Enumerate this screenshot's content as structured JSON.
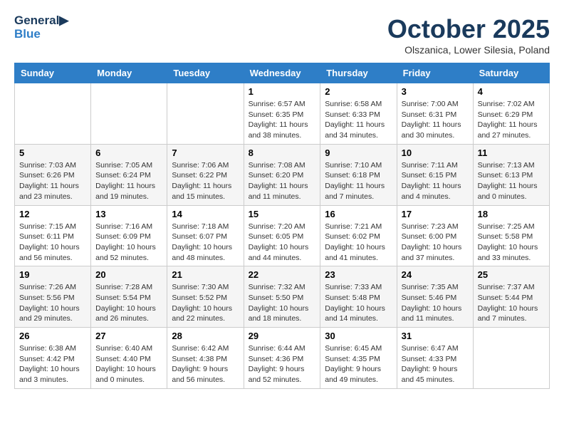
{
  "header": {
    "logo_line1": "General",
    "logo_line2": "Blue",
    "month_title": "October 2025",
    "subtitle": "Olszanica, Lower Silesia, Poland"
  },
  "weekdays": [
    "Sunday",
    "Monday",
    "Tuesday",
    "Wednesday",
    "Thursday",
    "Friday",
    "Saturday"
  ],
  "weeks": [
    [
      {
        "day": "",
        "info": ""
      },
      {
        "day": "",
        "info": ""
      },
      {
        "day": "",
        "info": ""
      },
      {
        "day": "1",
        "info": "Sunrise: 6:57 AM\nSunset: 6:35 PM\nDaylight: 11 hours\nand 38 minutes."
      },
      {
        "day": "2",
        "info": "Sunrise: 6:58 AM\nSunset: 6:33 PM\nDaylight: 11 hours\nand 34 minutes."
      },
      {
        "day": "3",
        "info": "Sunrise: 7:00 AM\nSunset: 6:31 PM\nDaylight: 11 hours\nand 30 minutes."
      },
      {
        "day": "4",
        "info": "Sunrise: 7:02 AM\nSunset: 6:29 PM\nDaylight: 11 hours\nand 27 minutes."
      }
    ],
    [
      {
        "day": "5",
        "info": "Sunrise: 7:03 AM\nSunset: 6:26 PM\nDaylight: 11 hours\nand 23 minutes."
      },
      {
        "day": "6",
        "info": "Sunrise: 7:05 AM\nSunset: 6:24 PM\nDaylight: 11 hours\nand 19 minutes."
      },
      {
        "day": "7",
        "info": "Sunrise: 7:06 AM\nSunset: 6:22 PM\nDaylight: 11 hours\nand 15 minutes."
      },
      {
        "day": "8",
        "info": "Sunrise: 7:08 AM\nSunset: 6:20 PM\nDaylight: 11 hours\nand 11 minutes."
      },
      {
        "day": "9",
        "info": "Sunrise: 7:10 AM\nSunset: 6:18 PM\nDaylight: 11 hours\nand 7 minutes."
      },
      {
        "day": "10",
        "info": "Sunrise: 7:11 AM\nSunset: 6:15 PM\nDaylight: 11 hours\nand 4 minutes."
      },
      {
        "day": "11",
        "info": "Sunrise: 7:13 AM\nSunset: 6:13 PM\nDaylight: 11 hours\nand 0 minutes."
      }
    ],
    [
      {
        "day": "12",
        "info": "Sunrise: 7:15 AM\nSunset: 6:11 PM\nDaylight: 10 hours\nand 56 minutes."
      },
      {
        "day": "13",
        "info": "Sunrise: 7:16 AM\nSunset: 6:09 PM\nDaylight: 10 hours\nand 52 minutes."
      },
      {
        "day": "14",
        "info": "Sunrise: 7:18 AM\nSunset: 6:07 PM\nDaylight: 10 hours\nand 48 minutes."
      },
      {
        "day": "15",
        "info": "Sunrise: 7:20 AM\nSunset: 6:05 PM\nDaylight: 10 hours\nand 44 minutes."
      },
      {
        "day": "16",
        "info": "Sunrise: 7:21 AM\nSunset: 6:02 PM\nDaylight: 10 hours\nand 41 minutes."
      },
      {
        "day": "17",
        "info": "Sunrise: 7:23 AM\nSunset: 6:00 PM\nDaylight: 10 hours\nand 37 minutes."
      },
      {
        "day": "18",
        "info": "Sunrise: 7:25 AM\nSunset: 5:58 PM\nDaylight: 10 hours\nand 33 minutes."
      }
    ],
    [
      {
        "day": "19",
        "info": "Sunrise: 7:26 AM\nSunset: 5:56 PM\nDaylight: 10 hours\nand 29 minutes."
      },
      {
        "day": "20",
        "info": "Sunrise: 7:28 AM\nSunset: 5:54 PM\nDaylight: 10 hours\nand 26 minutes."
      },
      {
        "day": "21",
        "info": "Sunrise: 7:30 AM\nSunset: 5:52 PM\nDaylight: 10 hours\nand 22 minutes."
      },
      {
        "day": "22",
        "info": "Sunrise: 7:32 AM\nSunset: 5:50 PM\nDaylight: 10 hours\nand 18 minutes."
      },
      {
        "day": "23",
        "info": "Sunrise: 7:33 AM\nSunset: 5:48 PM\nDaylight: 10 hours\nand 14 minutes."
      },
      {
        "day": "24",
        "info": "Sunrise: 7:35 AM\nSunset: 5:46 PM\nDaylight: 10 hours\nand 11 minutes."
      },
      {
        "day": "25",
        "info": "Sunrise: 7:37 AM\nSunset: 5:44 PM\nDaylight: 10 hours\nand 7 minutes."
      }
    ],
    [
      {
        "day": "26",
        "info": "Sunrise: 6:38 AM\nSunset: 4:42 PM\nDaylight: 10 hours\nand 3 minutes."
      },
      {
        "day": "27",
        "info": "Sunrise: 6:40 AM\nSunset: 4:40 PM\nDaylight: 10 hours\nand 0 minutes."
      },
      {
        "day": "28",
        "info": "Sunrise: 6:42 AM\nSunset: 4:38 PM\nDaylight: 9 hours\nand 56 minutes."
      },
      {
        "day": "29",
        "info": "Sunrise: 6:44 AM\nSunset: 4:36 PM\nDaylight: 9 hours\nand 52 minutes."
      },
      {
        "day": "30",
        "info": "Sunrise: 6:45 AM\nSunset: 4:35 PM\nDaylight: 9 hours\nand 49 minutes."
      },
      {
        "day": "31",
        "info": "Sunrise: 6:47 AM\nSunset: 4:33 PM\nDaylight: 9 hours\nand 45 minutes."
      },
      {
        "day": "",
        "info": ""
      }
    ]
  ]
}
